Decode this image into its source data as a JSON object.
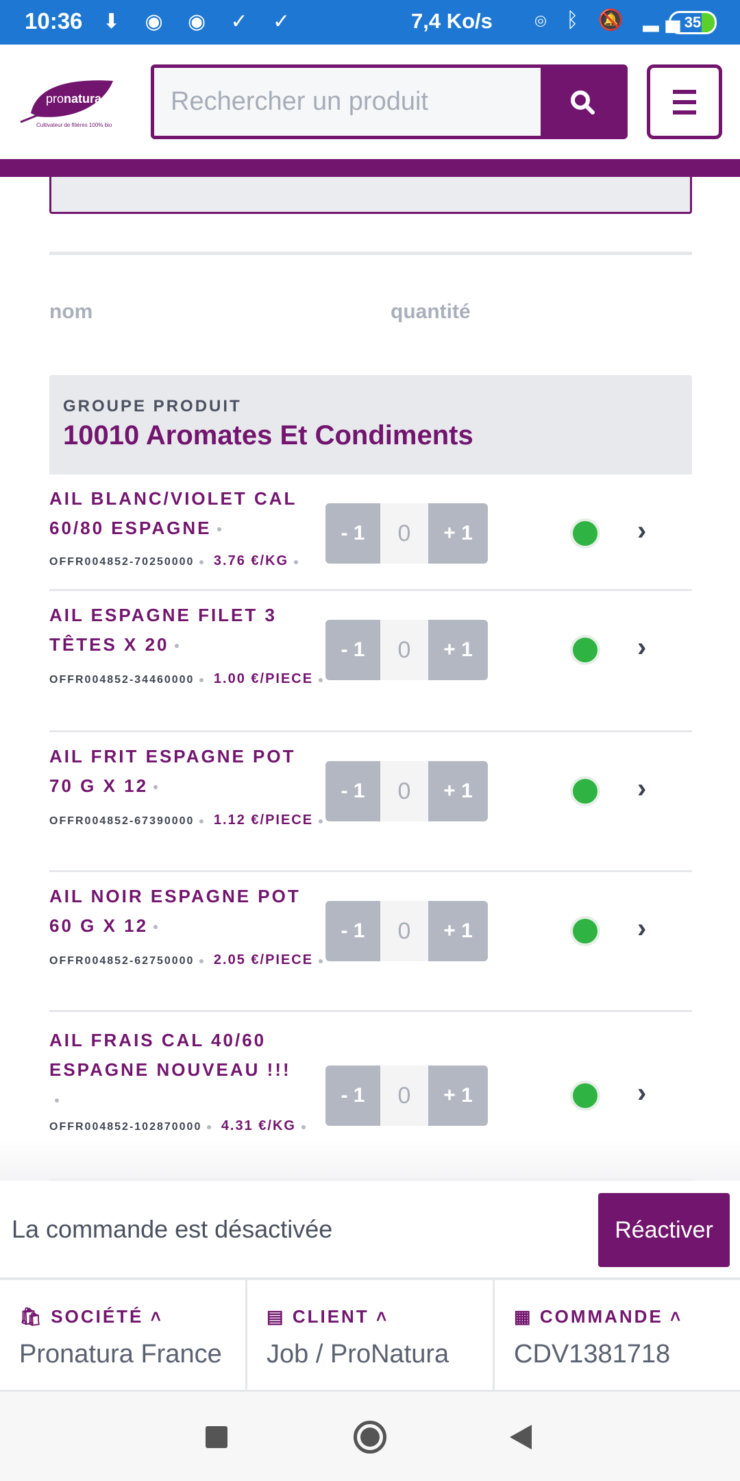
{
  "status_bar": {
    "time": "10:36",
    "speed": "7,4 Ko/s",
    "battery": "35",
    "left_icons": [
      "maps-icon",
      "download-icon",
      "circle-icon",
      "circle-icon",
      "check-icon",
      "check-icon"
    ],
    "right_icons": [
      "hotspot-icon",
      "bluetooth-icon",
      "mute-icon",
      "signal-icon",
      "wifi-icon"
    ]
  },
  "header": {
    "logo_text": "pronatura",
    "logo_tagline": "Cultivateur de filières 100% bio",
    "search_placeholder": "Rechercher un produit",
    "brand_color": "#72156e"
  },
  "columns": {
    "name": "nom",
    "quantity": "quantité"
  },
  "group": {
    "label": "GROUPE PRODUIT",
    "title": "10010 Aromates Et Condiments"
  },
  "products": [
    {
      "name": "AIL BLANC/VIOLET CAL 60/80 ESPAGNE",
      "code": "OFFR004852-70250000",
      "price": "3.76 €/KG",
      "qty": "0",
      "minus": "- 1",
      "plus": "+ 1",
      "available": true
    },
    {
      "name": "AIL ESPAGNE FILET 3 TÊTES X 20",
      "code": "OFFR004852-34460000",
      "price": "1.00 €/PIECE",
      "qty": "0",
      "minus": "- 1",
      "plus": "+ 1",
      "available": true
    },
    {
      "name": "AIL FRIT ESPAGNE POT 70 G X 12",
      "code": "OFFR004852-67390000",
      "price": "1.12 €/PIECE",
      "qty": "0",
      "minus": "- 1",
      "plus": "+ 1",
      "available": true
    },
    {
      "name": "AIL NOIR ESPAGNE POT 60 G X 12",
      "code": "OFFR004852-62750000",
      "price": "2.05 €/PIECE",
      "qty": "0",
      "minus": "- 1",
      "plus": "+ 1",
      "available": true
    },
    {
      "name": "AIL FRAIS CAL 40/60 ESPAGNE NOUVEAU !!!",
      "code": "OFFR004852-102870000",
      "price": "4.31 €/KG",
      "qty": "0",
      "minus": "- 1",
      "plus": "+ 1",
      "available": true
    }
  ],
  "order_bar": {
    "message": "La commande est désactivée",
    "reactivate": "Réactiver"
  },
  "info": [
    {
      "label": "SOCIÉTÉ",
      "value": "Pronatura France",
      "icon": "bag-icon"
    },
    {
      "label": "CLIENT",
      "value": "Job / ProNatura",
      "icon": "store-icon"
    },
    {
      "label": "COMMANDE",
      "value": "CDV1381718",
      "icon": "receipt-icon"
    }
  ]
}
